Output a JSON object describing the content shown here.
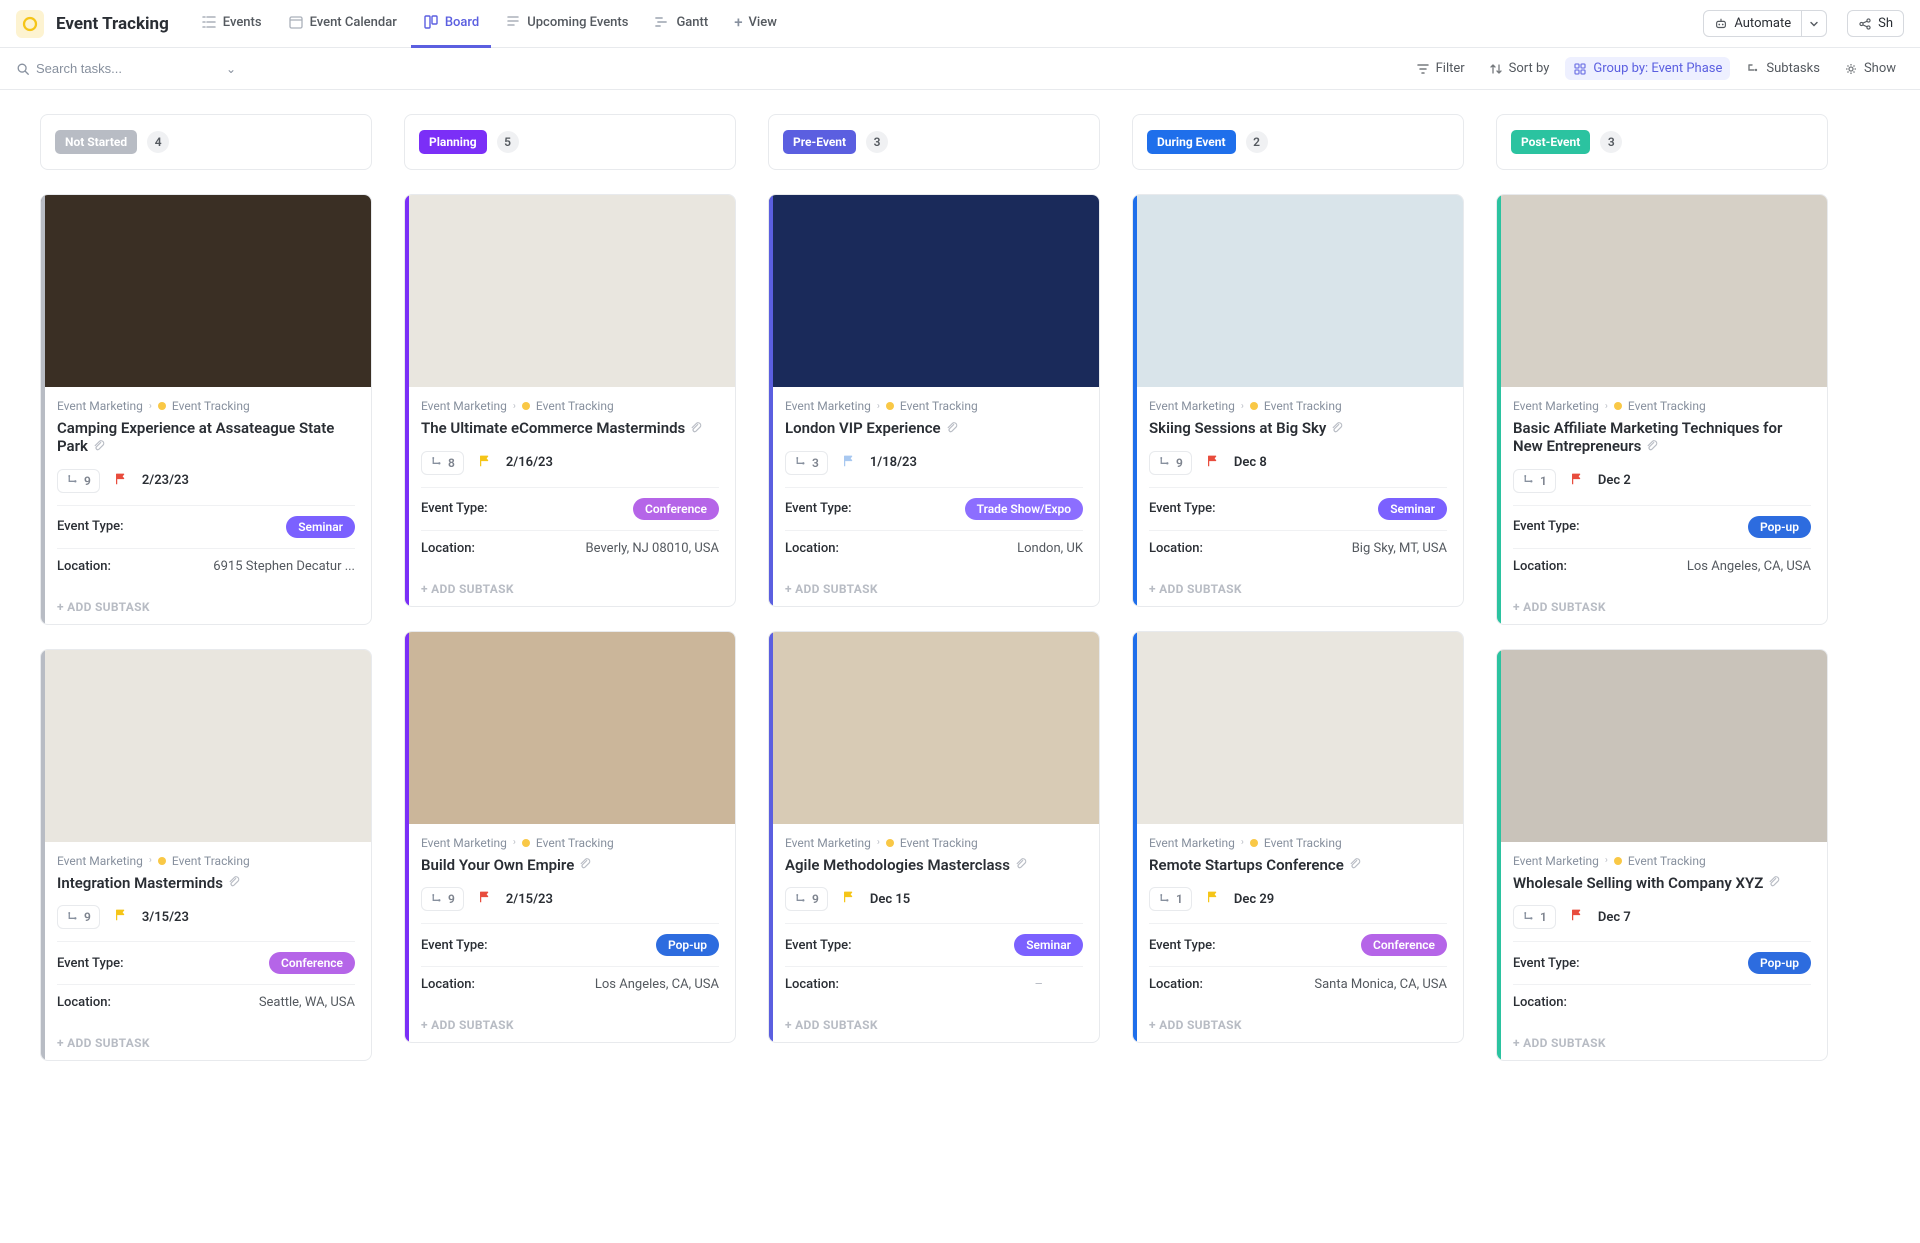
{
  "header": {
    "title": "Event Tracking",
    "tabs": [
      {
        "id": "events",
        "label": "Events"
      },
      {
        "id": "calendar",
        "label": "Event Calendar"
      },
      {
        "id": "board",
        "label": "Board"
      },
      {
        "id": "upcoming",
        "label": "Upcoming Events"
      },
      {
        "id": "gantt",
        "label": "Gantt"
      },
      {
        "id": "addview",
        "label": "View"
      }
    ],
    "automate_label": "Automate",
    "share_label": "Sh"
  },
  "toolbar": {
    "search_placeholder": "Search tasks...",
    "filter": "Filter",
    "sort": "Sort by",
    "group": "Group by: Event Phase",
    "subtasks": "Subtasks",
    "show": "Show"
  },
  "columns": [
    {
      "id": "notstarted",
      "label": "Not Started",
      "count": "4",
      "stripe": "stripe-grey",
      "badge": "badge-grey"
    },
    {
      "id": "planning",
      "label": "Planning",
      "count": "5",
      "stripe": "stripe-purple",
      "badge": "badge-purple"
    },
    {
      "id": "preevent",
      "label": "Pre-Event",
      "count": "3",
      "stripe": "stripe-violet",
      "badge": "badge-violet"
    },
    {
      "id": "during",
      "label": "During Event",
      "count": "2",
      "stripe": "stripe-blue",
      "badge": "badge-blue"
    },
    {
      "id": "post",
      "label": "Post-Event",
      "count": "3",
      "stripe": "stripe-teal",
      "badge": "badge-teal"
    }
  ],
  "breadcrumb": {
    "parent": "Event Marketing",
    "child": "Event Tracking"
  },
  "labels": {
    "event_type": "Event Type:",
    "location": "Location:",
    "add_subtask": "+ ADD SUBTASK"
  },
  "cards": {
    "notstarted": [
      {
        "title": "Camping Experience at Assateague State Park",
        "sub": "9",
        "flag": "flag-red",
        "date": "2/23/23",
        "type": "Seminar",
        "type_class": "type-seminar",
        "location": "6915 Stephen Decatur ...",
        "stripe": "#b8bcc4",
        "cover_bg": "#3a2f24"
      },
      {
        "title": "Integration Masterminds",
        "sub": "9",
        "flag": "flag-yellow",
        "date": "3/15/23",
        "type": "Conference",
        "type_class": "type-conference",
        "location": "Seattle, WA, USA",
        "stripe": "#b8bcc4",
        "cover_bg": "#e9e6df"
      }
    ],
    "planning": [
      {
        "title": "The Ultimate eCommerce Masterminds",
        "sub": "8",
        "flag": "flag-yellow",
        "date": "2/16/23",
        "type": "Conference",
        "type_class": "type-conference",
        "location": "Beverly, NJ 08010, USA",
        "stripe": "#7b2ff7",
        "cover_bg": "#e9e6df"
      },
      {
        "title": "Build Your Own Empire",
        "sub": "9",
        "flag": "flag-red",
        "date": "2/15/23",
        "type": "Pop-up",
        "type_class": "type-popup",
        "location": "Los Angeles, CA, USA",
        "stripe": "#7b2ff7",
        "cover_bg": "#cbb69a"
      }
    ],
    "preevent": [
      {
        "title": "London VIP Experience",
        "sub": "3",
        "flag": "flag-blue",
        "date": "1/18/23",
        "type": "Trade Show/Expo",
        "type_class": "type-tradeshow",
        "location": "London, UK",
        "stripe": "#5b5fe0",
        "cover_bg": "#1a2a5a"
      },
      {
        "title": "Agile Methodologies Masterclass",
        "sub": "9",
        "flag": "flag-yellow",
        "date": "Dec 15",
        "type": "Seminar",
        "type_class": "type-seminar",
        "location": "–",
        "stripe": "#5b5fe0",
        "cover_bg": "#d8cbb5",
        "location_dash": true
      }
    ],
    "during": [
      {
        "title": "Skiing Sessions at Big Sky",
        "sub": "9",
        "flag": "flag-red",
        "date": "Dec 8",
        "type": "Seminar",
        "type_class": "type-seminar",
        "location": "Big Sky, MT, USA",
        "stripe": "#1f6feb",
        "cover_bg": "#d9e4ea"
      },
      {
        "title": "Remote Startups Conference",
        "sub": "1",
        "flag": "flag-yellow",
        "date": "Dec 29",
        "type": "Conference",
        "type_class": "type-conference",
        "location": "Santa Monica, CA, USA",
        "stripe": "#1f6feb",
        "cover_bg": "#e9e6df"
      }
    ],
    "post": [
      {
        "title": "Basic Affiliate Marketing Techniques for New Entrepreneurs",
        "sub": "1",
        "flag": "flag-red",
        "date": "Dec 2",
        "type": "Pop-up",
        "type_class": "type-popup",
        "location": "Los Angeles, CA, USA",
        "stripe": "#2bc3a0",
        "cover_bg": "#d6d0c6"
      },
      {
        "title": "Wholesale Selling with Company XYZ",
        "sub": "1",
        "flag": "flag-red",
        "date": "Dec 7",
        "type": "Pop-up",
        "type_class": "type-popup",
        "location": "",
        "stripe": "#2bc3a0",
        "cover_bg": "#c9c3ba"
      }
    ]
  }
}
